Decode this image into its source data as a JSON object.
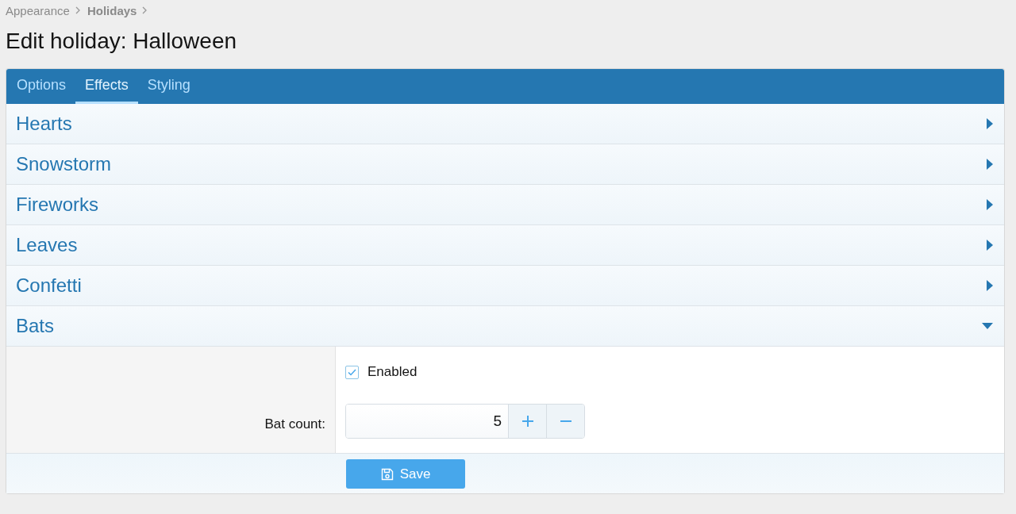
{
  "breadcrumb": [
    {
      "label": "Appearance",
      "current": false
    },
    {
      "label": "Holidays",
      "current": true
    }
  ],
  "title": "Edit holiday: Halloween",
  "tabs": [
    {
      "label": "Options",
      "selected": false
    },
    {
      "label": "Effects",
      "selected": true
    },
    {
      "label": "Styling",
      "selected": false
    }
  ],
  "sections": [
    {
      "label": "Hearts",
      "expanded": false
    },
    {
      "label": "Snowstorm",
      "expanded": false
    },
    {
      "label": "Fireworks",
      "expanded": false
    },
    {
      "label": "Leaves",
      "expanded": false
    },
    {
      "label": "Confetti",
      "expanded": false
    },
    {
      "label": "Bats",
      "expanded": true
    }
  ],
  "bats": {
    "enabled": {
      "label": "Enabled",
      "checked": true
    },
    "count": {
      "label": "Bat count:",
      "value": "5"
    }
  },
  "save_button": "Save"
}
